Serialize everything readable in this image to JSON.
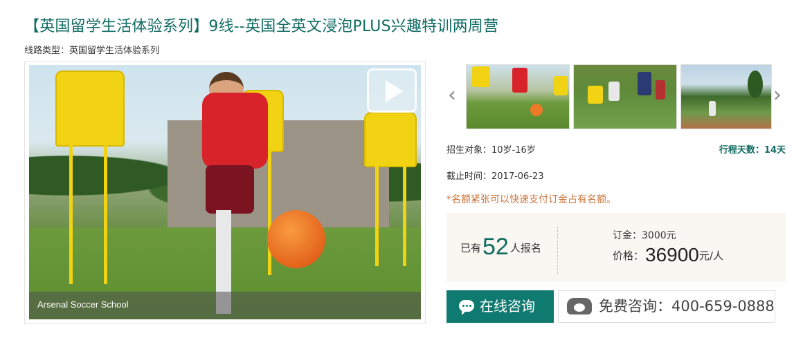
{
  "header": {
    "title": "【英国留学生活体验系列】9线--英国全英文浸泡PLUS兴趣特训两周营",
    "route_label": "线路类型：",
    "route_value": "英国留学生活体验系列"
  },
  "main_image": {
    "caption": "Arsenal Soccer School",
    "play_icon": "video-play-icon"
  },
  "thumbnails": {
    "prev_arrow": "‹",
    "next_arrow": "›",
    "count": 3
  },
  "details": {
    "audience_label": "招生对象：",
    "audience_value": "10岁-16岁",
    "days_label": "行程天数：",
    "days_value": "14天",
    "deadline_label": "截止时间：",
    "deadline_value": "2017-06-23",
    "notice": "*名额紧张可以快速支付订金占有名额。"
  },
  "pricing": {
    "signup_prefix": "已有",
    "signup_count": "52",
    "signup_suffix": "人报名",
    "deposit_label": "订金：",
    "deposit_value": "3000元",
    "price_label": "价格：",
    "price_value": "36900",
    "price_unit": "元/人"
  },
  "actions": {
    "online_consult": "在线咨询",
    "phone_label": "免费咨询：",
    "phone_number": "400-659-0888"
  },
  "colors": {
    "accent": "#0f6b62",
    "button": "#0f7a70",
    "notice": "#c9753c",
    "price_bg": "#faf6f1"
  }
}
